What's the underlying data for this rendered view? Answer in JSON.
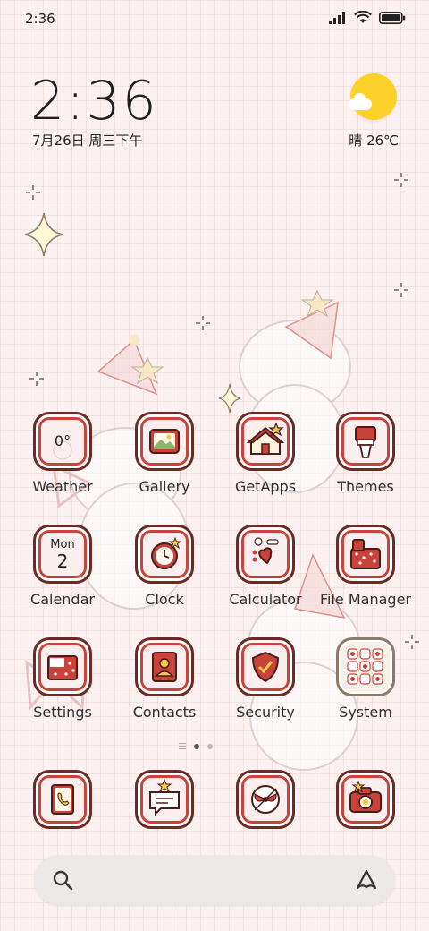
{
  "status_bar": {
    "time": "2:36",
    "icons": [
      "signal-icon",
      "wifi-icon",
      "battery-icon"
    ]
  },
  "clock_widget": {
    "time": "2:36",
    "date": "7月26日 周三下午"
  },
  "weather_widget": {
    "text": "晴 26℃",
    "icon": "sun-cloud-icon"
  },
  "apps": [
    {
      "label": "Weather",
      "icon": "weather-icon",
      "overlay": "0°"
    },
    {
      "label": "Gallery",
      "icon": "gallery-icon"
    },
    {
      "label": "GetApps",
      "icon": "getapps-icon"
    },
    {
      "label": "Themes",
      "icon": "themes-icon"
    },
    {
      "label": "Calendar",
      "icon": "calendar-icon",
      "day": "Mon",
      "date": "2"
    },
    {
      "label": "Clock",
      "icon": "clock-icon"
    },
    {
      "label": "Calculator",
      "icon": "calculator-icon"
    },
    {
      "label": "File Manager",
      "icon": "file-manager-icon"
    },
    {
      "label": "Settings",
      "icon": "settings-icon"
    },
    {
      "label": "Contacts",
      "icon": "contacts-icon"
    },
    {
      "label": "Security",
      "icon": "security-icon"
    },
    {
      "label": "System",
      "icon": "system-folder-icon"
    }
  ],
  "dock": [
    {
      "icon": "phone-icon"
    },
    {
      "icon": "messages-icon"
    },
    {
      "icon": "browser-icon"
    },
    {
      "icon": "camera-icon"
    }
  ],
  "pager": {
    "pages": 2,
    "active": 1
  },
  "search_bar": {
    "left_icon": "search-icon",
    "right_icon": "assistant-icon"
  },
  "colors": {
    "accent_red": "#c9433b",
    "outline": "#6b2a23",
    "sun": "#fcd12a"
  }
}
